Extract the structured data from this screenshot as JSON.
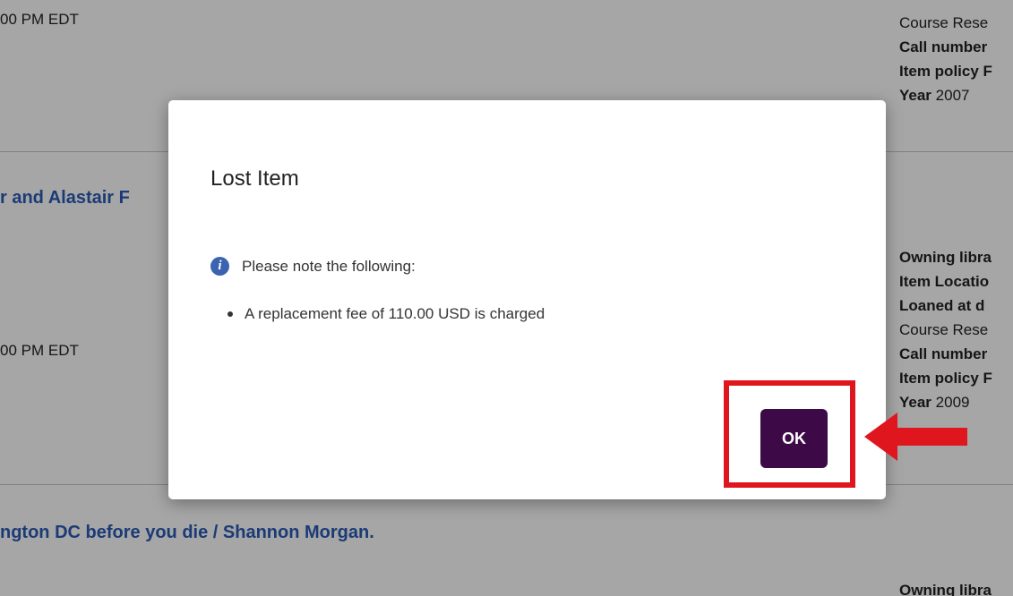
{
  "background": {
    "times": [
      "00 PM EDT",
      "00 PM EDT"
    ],
    "titles": [
      "r and Alastair F",
      "ngton DC before you die / Shannon Morgan."
    ],
    "meta_block_1": [
      {
        "bold": "",
        "text": "Course Rese"
      },
      {
        "bold": "Call number",
        "text": ""
      },
      {
        "bold": "Item policy F",
        "text": ""
      },
      {
        "bold": "Year",
        "text": " 2007"
      }
    ],
    "meta_block_2": [
      {
        "bold": "Owning libra",
        "text": ""
      },
      {
        "bold": "Item Locatio",
        "text": ""
      },
      {
        "bold": "Loaned at d",
        "text": ""
      },
      {
        "bold": "",
        "text": "Course Rese"
      },
      {
        "bold": "Call number",
        "text": ""
      },
      {
        "bold": "Item policy F",
        "text": ""
      },
      {
        "bold": "Year",
        "text": " 2009"
      }
    ],
    "meta_block_3": [
      {
        "bold": "Owning libra",
        "text": ""
      }
    ]
  },
  "dialog": {
    "title": "Lost Item",
    "info_text": "Please note the following:",
    "bullet_text": "A replacement fee of 110.00 USD is charged",
    "ok_label": "OK",
    "info_icon_glyph": "i"
  },
  "colors": {
    "link": "#2a5bb5",
    "ok_button": "#3d0a47",
    "highlight": "#e0161e",
    "info_icon": "#3b63b0"
  }
}
